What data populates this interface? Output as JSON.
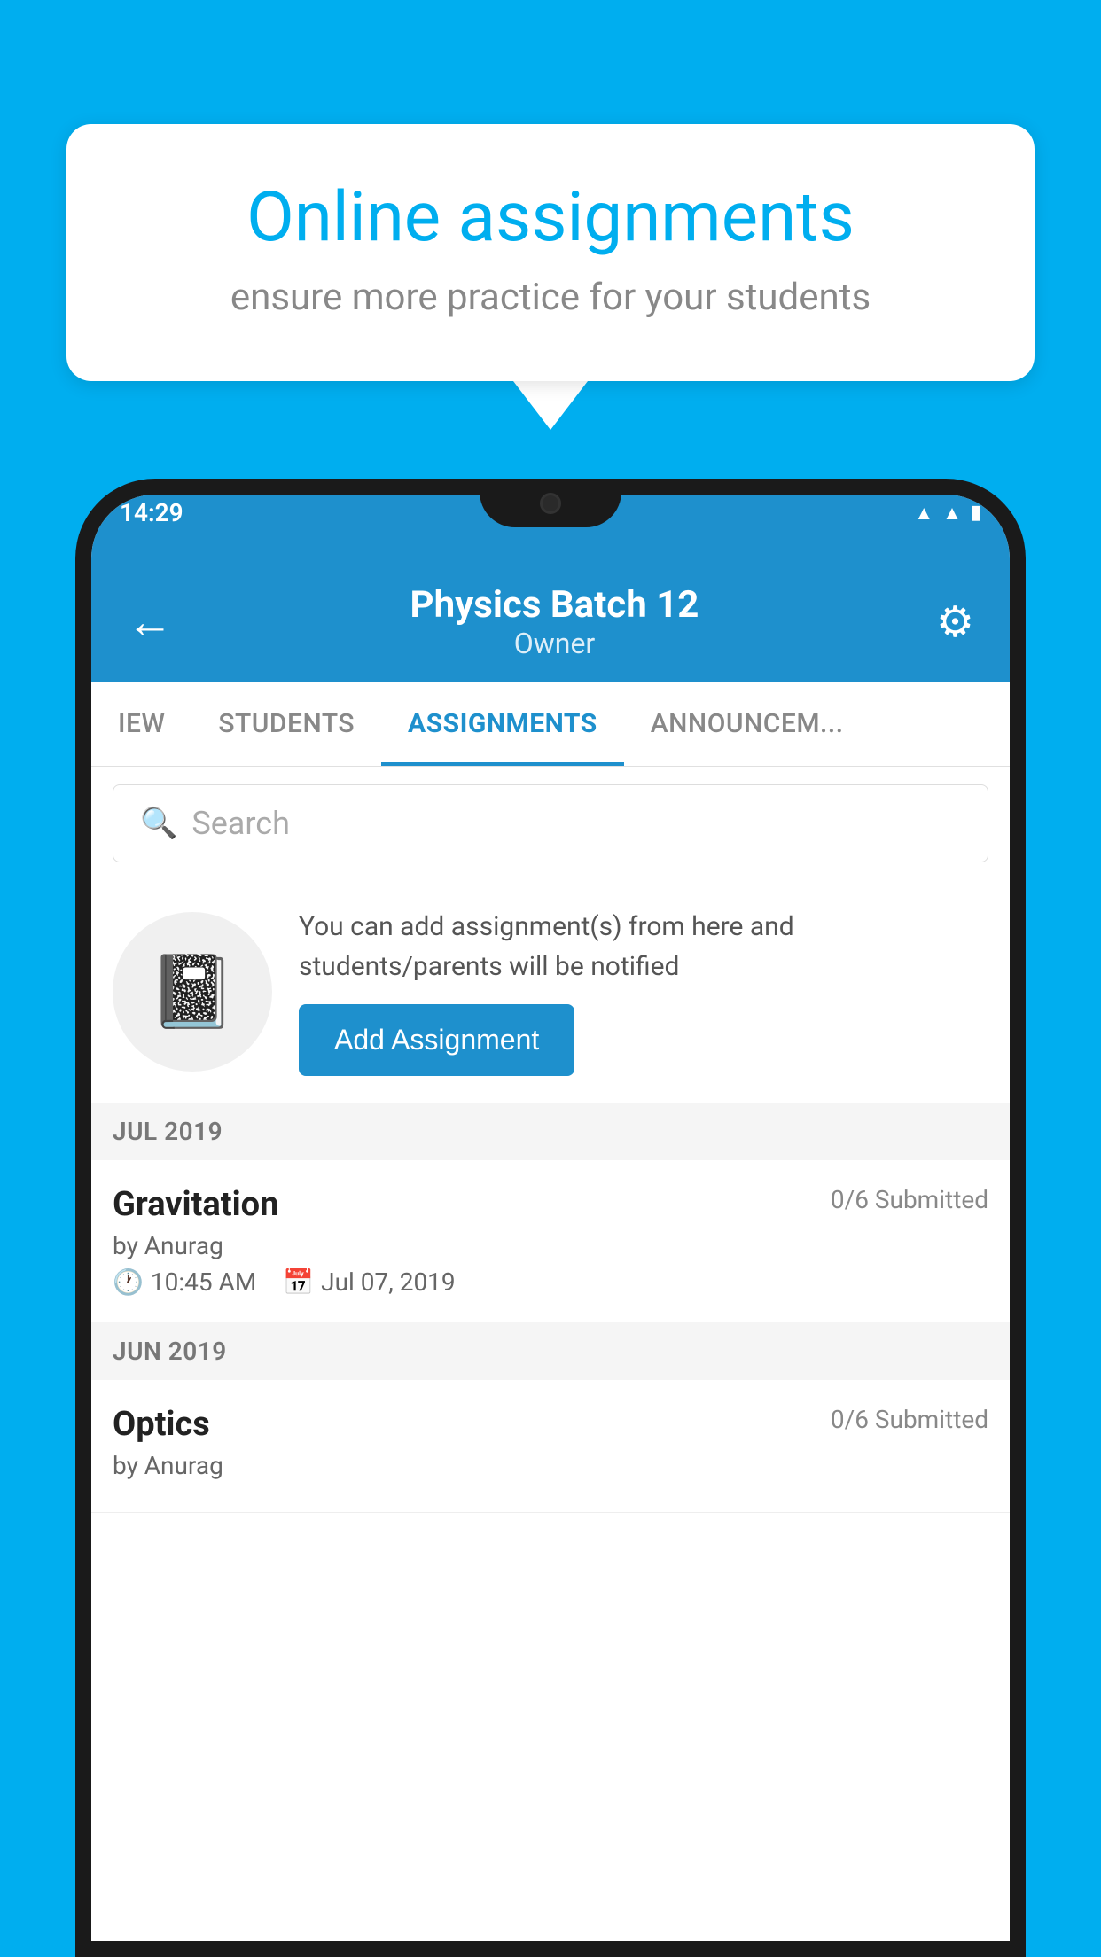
{
  "background_color": "#00AEEF",
  "speech_bubble": {
    "title": "Online assignments",
    "subtitle": "ensure more practice for your students"
  },
  "phone": {
    "status_bar": {
      "time": "14:29",
      "wifi": "wifi",
      "signal": "signal",
      "battery": "battery"
    },
    "header": {
      "title": "Physics Batch 12",
      "subtitle": "Owner",
      "back_label": "←",
      "settings_label": "⚙"
    },
    "tabs": [
      {
        "label": "IEW",
        "active": false
      },
      {
        "label": "STUDENTS",
        "active": false
      },
      {
        "label": "ASSIGNMENTS",
        "active": true
      },
      {
        "label": "ANNOUNCEM...",
        "active": false
      }
    ],
    "search": {
      "placeholder": "Search"
    },
    "add_assignment_section": {
      "description": "You can add assignment(s) from here and students/parents will be notified",
      "button_label": "Add Assignment"
    },
    "assignment_sections": [
      {
        "month_label": "JUL 2019",
        "assignments": [
          {
            "name": "Gravitation",
            "submitted": "0/6 Submitted",
            "by": "by Anurag",
            "time": "10:45 AM",
            "date": "Jul 07, 2019"
          }
        ]
      },
      {
        "month_label": "JUN 2019",
        "assignments": [
          {
            "name": "Optics",
            "submitted": "0/6 Submitted",
            "by": "by Anurag",
            "time": "",
            "date": ""
          }
        ]
      }
    ]
  }
}
